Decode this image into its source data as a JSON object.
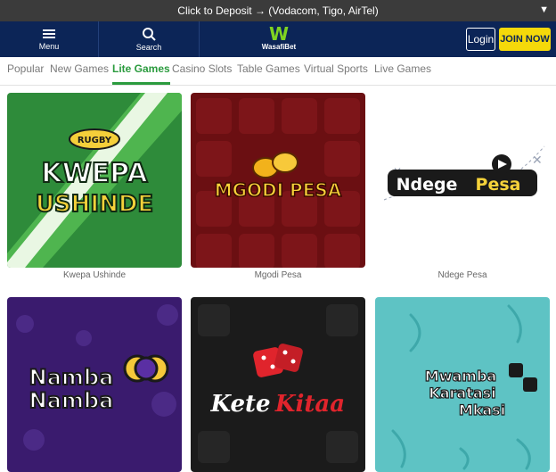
{
  "promo": {
    "text": "Click to Deposit → (Vodacom, Tigo, AirTel)",
    "caret": "▼"
  },
  "header": {
    "menu_label": "Menu",
    "search_label": "Search",
    "logo_text": "WasafiBet",
    "login_label": "Login",
    "join_label": "JOIN NOW"
  },
  "tabs": [
    {
      "label": "Popular"
    },
    {
      "label": "New Games"
    },
    {
      "label": "Lite Games",
      "active": true
    },
    {
      "label": "Casino Slots"
    },
    {
      "label": "Table Games"
    },
    {
      "label": "Virtual Sports"
    },
    {
      "label": "Live Games"
    }
  ],
  "games": [
    {
      "name": "Kwepa Ushinde",
      "art": [
        "KWEPA",
        "USHINDE"
      ],
      "badge": "RUGBY"
    },
    {
      "name": "Mgodi Pesa",
      "art": [
        "MGODI PESA"
      ]
    },
    {
      "name": "Ndege Pesa",
      "art": [
        "Ndege",
        "Pesa"
      ]
    },
    {
      "name": "",
      "art": [
        "Namba",
        "Namba"
      ]
    },
    {
      "name": "",
      "art": [
        "Kete",
        "Kitaa"
      ]
    },
    {
      "name": "",
      "art": [
        "Mwamba",
        "Karatasi",
        "Mkasi"
      ]
    }
  ],
  "colors": {
    "header": "#0c2557",
    "accent": "#2b9b3e",
    "join": "#f5d90a"
  }
}
